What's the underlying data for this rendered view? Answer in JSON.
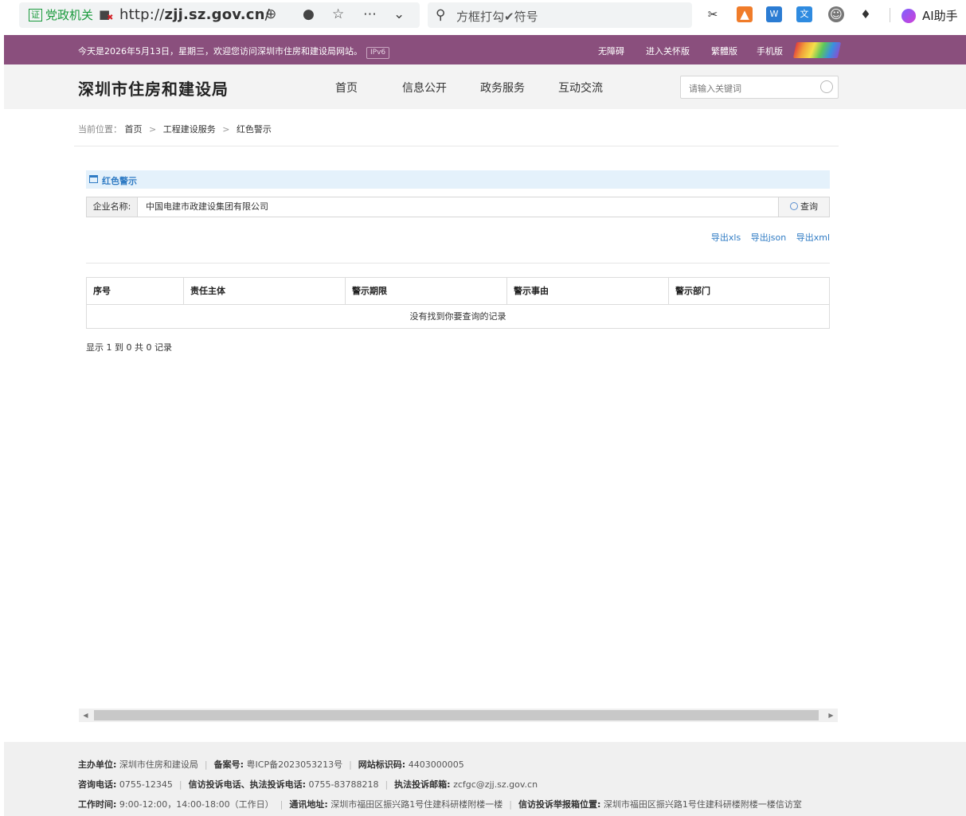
{
  "browser": {
    "cert_badge": "证",
    "cert_label": "党政机关",
    "url_prefix": "http://",
    "url_domain": "zjj.sz.gov.cn",
    "url_suffix": "/",
    "search_placeholder": "方框打勾✔符号",
    "ai_label": "AI助手"
  },
  "topbar": {
    "welcome": "今天是2026年5月13日，星期三，欢迎您访问深圳市住房和建设局网站。",
    "ipv6": "IPv6",
    "links": [
      "无障碍",
      "进入关怀版",
      "繁體版",
      "手机版"
    ]
  },
  "header": {
    "title": "深圳市住房和建设局",
    "nav": [
      "首页",
      "信息公开",
      "政务服务",
      "互动交流"
    ],
    "search_placeholder": "请输入关键词"
  },
  "breadcrumb": {
    "prefix": "当前位置：",
    "items": [
      "首页",
      "工程建设服务",
      "红色警示"
    ],
    "separator": ">"
  },
  "panel": {
    "title": "红色警示",
    "filter_label": "企业名称:",
    "filter_value": "中国电建市政建设集团有限公司",
    "query_button": "查询",
    "exports": [
      "导出xls",
      "导出json",
      "导出xml"
    ]
  },
  "table": {
    "columns": [
      "序号",
      "责任主体",
      "警示期限",
      "警示事由",
      "警示部门"
    ],
    "rows": [],
    "empty_text": "没有找到你要查询的记录",
    "pager_info": "显示 1 到 0 共 0 记录"
  },
  "footer": {
    "line1": [
      {
        "label": "主办单位:",
        "value": "深圳市住房和建设局"
      },
      {
        "label": "备案号:",
        "value": "粤ICP备2023053213号"
      },
      {
        "label": "网站标识码:",
        "value": "4403000005"
      }
    ],
    "line2": [
      {
        "label": "咨询电话:",
        "value": "0755-12345"
      },
      {
        "label": "信访投诉电话、执法投诉电话:",
        "value": "0755-83788218"
      },
      {
        "label": "执法投诉邮箱:",
        "value": "zcfgc@zjj.sz.gov.cn"
      }
    ],
    "line3": [
      {
        "label": "工作时间:",
        "value": "9:00-12:00，14:00-18:00（工作日）"
      },
      {
        "label": "通讯地址:",
        "value": "深圳市福田区振兴路1号住建科研楼附楼一楼"
      },
      {
        "label": "信访投诉举报箱位置:",
        "value": "深圳市福田区振兴路1号住建科研楼附楼一楼信访室"
      }
    ]
  },
  "colors": {
    "topbar_bg": "#8a4f7d",
    "link_blue": "#2f7bc4",
    "panel_head_bg": "#e4f1fb"
  }
}
